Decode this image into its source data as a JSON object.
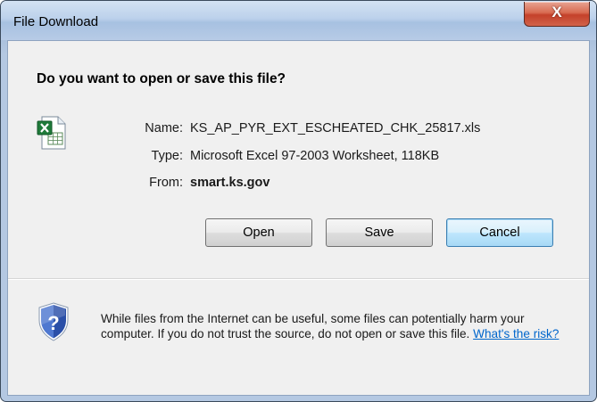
{
  "window": {
    "title": "File Download",
    "close_label": "X"
  },
  "dialog": {
    "heading": "Do you want to open or save this file?",
    "file_icon": "excel-file-icon",
    "fields": {
      "name_label": "Name:",
      "name_value": "KS_AP_PYR_EXT_ESCHEATED_CHK_25817.xls",
      "type_label": "Type:",
      "type_value": "Microsoft Excel 97-2003 Worksheet, 118KB",
      "from_label": "From:",
      "from_value": "smart.ks.gov"
    },
    "buttons": {
      "open": "Open",
      "save": "Save",
      "cancel": "Cancel"
    },
    "warning": {
      "icon": "shield-question-icon",
      "text": "While files from the Internet can be useful, some files can potentially harm your computer. If you do not trust the source, do not open or save this file.",
      "link_text": "What's the risk?"
    }
  },
  "colors": {
    "title_bar": "#b8cce4",
    "client_bg": "#f0f0f0",
    "close_button": "#c4412a",
    "default_button_border": "#3c7fb1",
    "link": "#0066cc",
    "shield_blue": "#2a4fa8"
  }
}
